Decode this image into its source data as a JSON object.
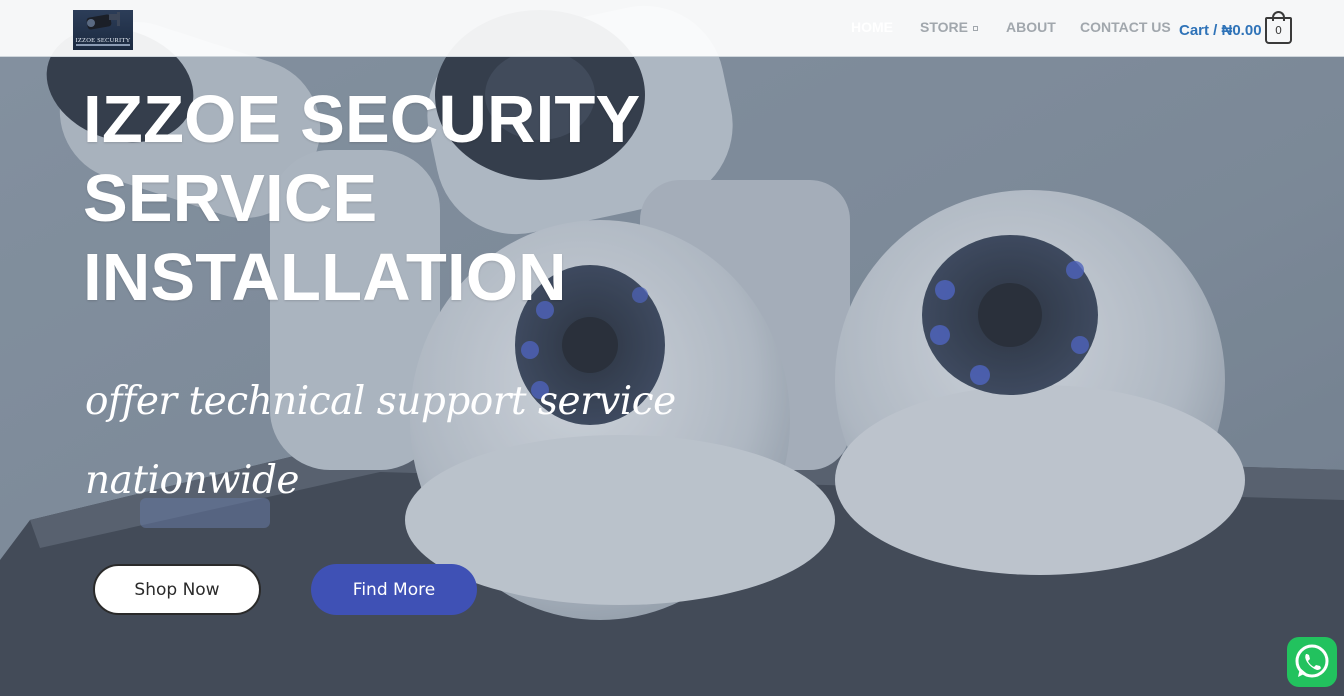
{
  "header": {
    "logo_text": "IZZOE SECURITY",
    "nav": [
      {
        "label": "HOME"
      },
      {
        "label": "STORE"
      },
      {
        "label": "ABOUT"
      },
      {
        "label": "CONTACT US"
      }
    ],
    "cart_label": "Cart / ₦0.00",
    "cart_count": "0"
  },
  "hero": {
    "headline_line1": "IZZOE SECURITY",
    "headline_line2": "SERVICE",
    "headline_line3": "INSTALLATION",
    "tagline_line1": "offer technical support service",
    "tagline_line2": "nationwide",
    "shop_button": "Shop Now",
    "find_button": "Find More"
  },
  "icons": {
    "store_dropdown": "chevron-down-icon",
    "cart": "shopping-bag-icon",
    "whatsapp": "whatsapp-icon"
  },
  "colors": {
    "accent_blue": "#3f51b5",
    "cart_blue": "#2f73b8",
    "whatsapp_green": "#22c25e",
    "hero_overlay": "#7d8a98"
  }
}
